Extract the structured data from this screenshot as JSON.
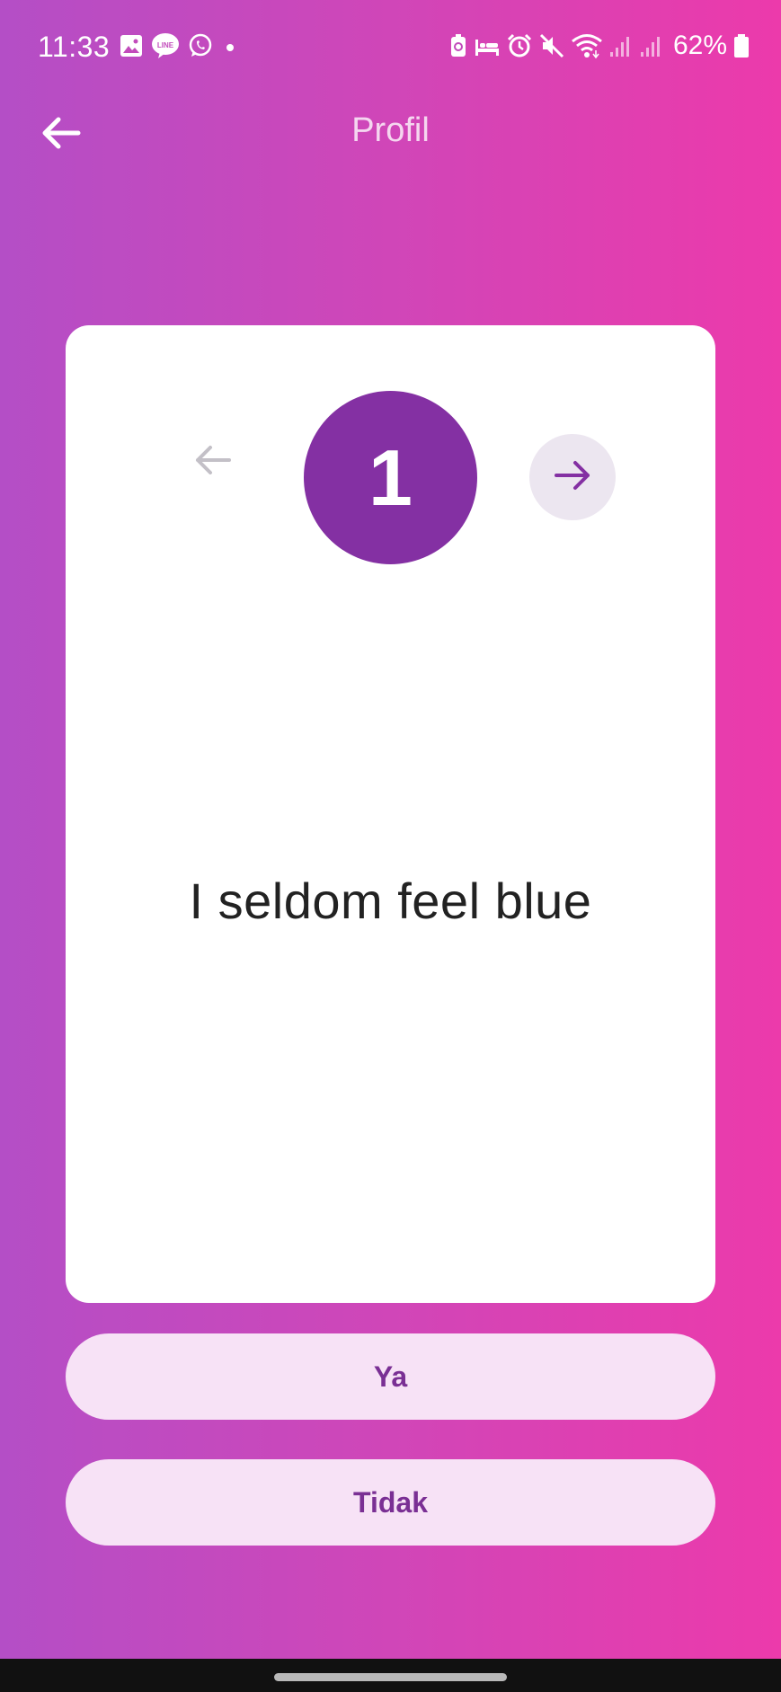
{
  "status_bar": {
    "time": "11:33",
    "battery": "62%",
    "left_icons": [
      "gallery-icon",
      "line-icon",
      "whatsapp-icon",
      "dot-icon"
    ],
    "right_icons": [
      "battery-saver-icon",
      "bed-icon",
      "alarm-icon",
      "mute-icon",
      "wifi-icon",
      "signal-icon",
      "signal-icon",
      "battery-icon"
    ]
  },
  "app_bar": {
    "title": "Profil",
    "back_icon": "arrow-left-icon"
  },
  "card": {
    "question_number": "1",
    "question_text": "I seldom feel blue",
    "prev_icon": "arrow-left-icon",
    "next_icon": "arrow-right-icon"
  },
  "answers": {
    "yes_label": "Ya",
    "no_label": "Tidak"
  },
  "colors": {
    "gradient_start": "#b44ec6",
    "gradient_end": "#ec3aab",
    "accent": "#8430a3",
    "button_bg": "#f7e2f6",
    "button_text": "#7a2f94"
  }
}
